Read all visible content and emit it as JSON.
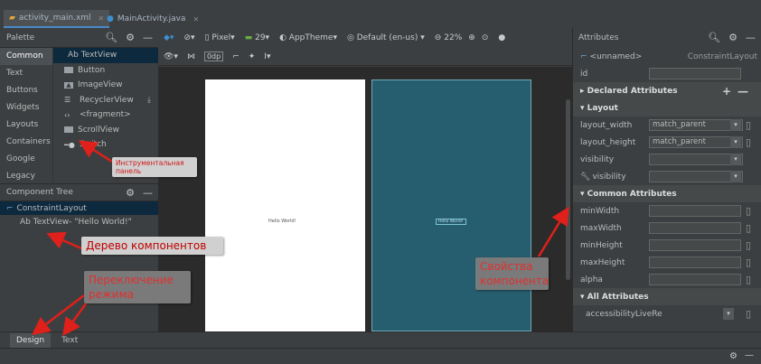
{
  "tabs": [
    {
      "label": "activity_main.xml",
      "icon": "xml-layout-icon"
    },
    {
      "label": "MainActivity.java",
      "icon": "java-class-icon"
    }
  ],
  "palette": {
    "title": "Palette",
    "categories": [
      "Common",
      "Text",
      "Buttons",
      "Widgets",
      "Layouts",
      "Containers",
      "Google",
      "Legacy"
    ],
    "items": [
      "Ab TextView",
      "Button",
      "ImageView",
      "RecyclerView",
      "<fragment>",
      "ScrollView",
      "Switch"
    ]
  },
  "toolbar": {
    "device": "Pixel",
    "api": "29",
    "theme": "AppTheme",
    "locale": "Default (en-us)",
    "zoom": "22%",
    "margin": "0dp"
  },
  "component_tree": {
    "title": "Component Tree",
    "root": "ConstraintLayout",
    "child": "Ab TextView- \"Hello World!\""
  },
  "canvas": {
    "design_text": "Hello World!",
    "blueprint_text": "Hello World!"
  },
  "attributes": {
    "title": "Attributes",
    "selected_name": "<unnamed>",
    "selected_type": "ConstraintLayout",
    "id_label": "id",
    "declared": "Declared Attributes",
    "layout_section": "Layout",
    "layout_width_label": "layout_width",
    "layout_width_value": "match_parent",
    "layout_height_label": "layout_height",
    "layout_height_value": "match_parent",
    "visibility_label": "visibility",
    "visibility_tools_label": "visibility",
    "common_section": "Common Attributes",
    "minWidth": "minWidth",
    "maxWidth": "maxWidth",
    "minHeight": "minHeight",
    "maxHeight": "maxHeight",
    "alpha": "alpha",
    "all_section": "All Attributes",
    "accessibility": "accessibilityLiveRe"
  },
  "bottom_tabs": [
    "Design",
    "Text"
  ],
  "annotations": {
    "palette": "Инструментальная панель",
    "tree": "Дерево компонентов",
    "mode": "Переключение режима",
    "props": "Свойства компонента"
  },
  "colors": {
    "annotation_arrow": "#e0201a",
    "blueprint": "#265e6f",
    "selection": "#0d293e",
    "accent": "#3d8fd1"
  }
}
